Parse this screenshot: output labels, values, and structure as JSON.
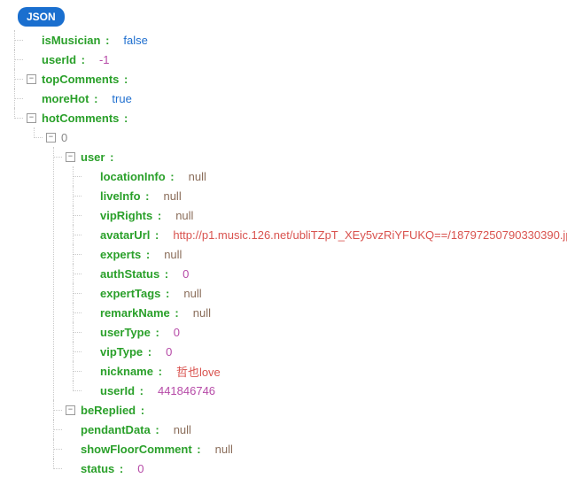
{
  "badge": "JSON",
  "glyph_expanded": "−",
  "glyph_collapsed": "+",
  "entries": [
    {
      "depth": 1,
      "toggle": null,
      "key": "isMusician",
      "val": "false",
      "vclass": "val-bool"
    },
    {
      "depth": 1,
      "toggle": null,
      "key": "userId",
      "val": "-1",
      "vclass": "val-num"
    },
    {
      "depth": 1,
      "toggle": "exp",
      "key": "topComments",
      "val": null,
      "vclass": ""
    },
    {
      "depth": 1,
      "toggle": null,
      "key": "moreHot",
      "val": "true",
      "vclass": "val-bool"
    },
    {
      "depth": 1,
      "toggle": "exp",
      "key": "hotComments",
      "val": null,
      "vclass": ""
    },
    {
      "depth": 2,
      "toggle": "exp",
      "key": "0",
      "idx": true,
      "val": null,
      "vclass": ""
    },
    {
      "depth": 3,
      "toggle": "exp",
      "key": "user",
      "val": null,
      "vclass": ""
    },
    {
      "depth": 4,
      "toggle": null,
      "key": "locationInfo",
      "val": "null",
      "vclass": "val-null"
    },
    {
      "depth": 4,
      "toggle": null,
      "key": "liveInfo",
      "val": "null",
      "vclass": "val-null"
    },
    {
      "depth": 4,
      "toggle": null,
      "key": "vipRights",
      "val": "null",
      "vclass": "val-null"
    },
    {
      "depth": 4,
      "toggle": null,
      "key": "avatarUrl",
      "val": "http://p1.music.126.net/ubliTZpT_XEy5vzRiYFUKQ==/18797250790330390.jpg",
      "vclass": "val-str"
    },
    {
      "depth": 4,
      "toggle": null,
      "key": "experts",
      "val": "null",
      "vclass": "val-null"
    },
    {
      "depth": 4,
      "toggle": null,
      "key": "authStatus",
      "val": "0",
      "vclass": "val-num"
    },
    {
      "depth": 4,
      "toggle": null,
      "key": "expertTags",
      "val": "null",
      "vclass": "val-null"
    },
    {
      "depth": 4,
      "toggle": null,
      "key": "remarkName",
      "val": "null",
      "vclass": "val-null"
    },
    {
      "depth": 4,
      "toggle": null,
      "key": "userType",
      "val": "0",
      "vclass": "val-num"
    },
    {
      "depth": 4,
      "toggle": null,
      "key": "vipType",
      "val": "0",
      "vclass": "val-num"
    },
    {
      "depth": 4,
      "toggle": null,
      "key": "nickname",
      "val": "哲也love",
      "vclass": "val-str"
    },
    {
      "depth": 4,
      "toggle": null,
      "key": "userId",
      "val": "441846746",
      "vclass": "val-num"
    },
    {
      "depth": 3,
      "toggle": "exp",
      "key": "beReplied",
      "val": null,
      "vclass": ""
    },
    {
      "depth": 3,
      "toggle": null,
      "key": "pendantData",
      "val": "null",
      "vclass": "val-null"
    },
    {
      "depth": 3,
      "toggle": null,
      "key": "showFloorComment",
      "val": "null",
      "vclass": "val-null"
    },
    {
      "depth": 3,
      "toggle": null,
      "key": "status",
      "val": "0",
      "vclass": "val-num"
    }
  ]
}
